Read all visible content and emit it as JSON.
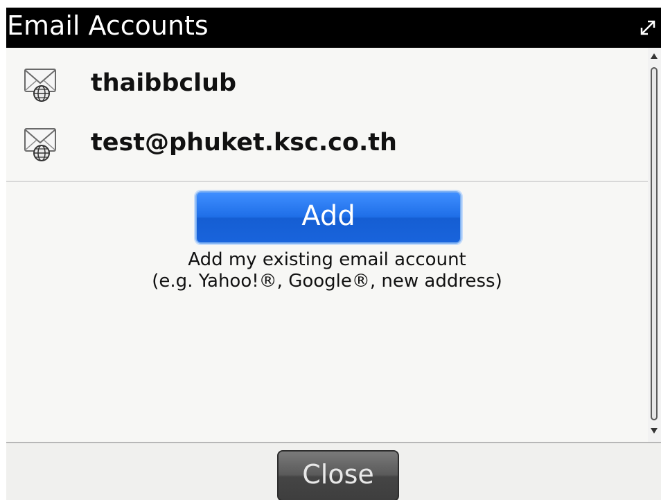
{
  "window": {
    "title": "Email Accounts",
    "expand_icon": "expand-arrows-icon"
  },
  "accounts": [
    {
      "name": "thaibbclub",
      "icon": "mail-globe-icon"
    },
    {
      "name": "test@phuket.ksc.co.th",
      "icon": "mail-globe-icon"
    }
  ],
  "add_section": {
    "button_label": "Add",
    "description_line1": "Add my existing email account",
    "description_line2": "(e.g. Yahoo!®, Google®, new address)"
  },
  "footer": {
    "close_label": "Close"
  },
  "colors": {
    "titlebar": "#000000",
    "add_button": "#1f6fe8",
    "close_button": "#4a4a4a"
  }
}
